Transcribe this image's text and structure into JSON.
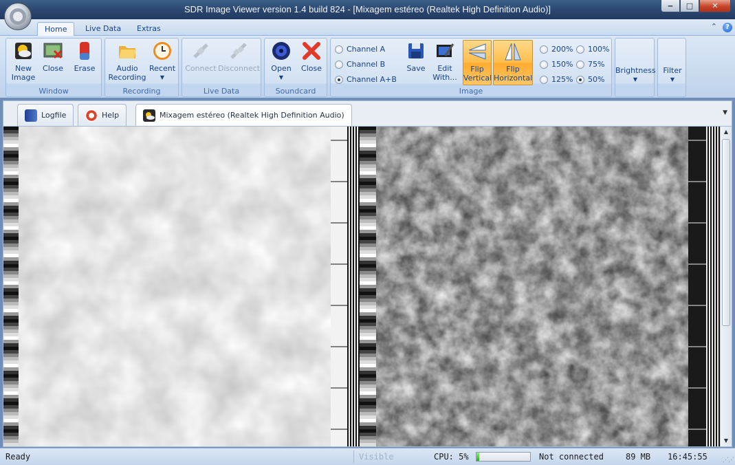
{
  "window": {
    "title": "SDR Image Viewer version 1.4 build 824 - [Mixagem estéreo (Realtek High Definition Audio)]",
    "minimize_glyph": "‒",
    "maximize_glyph": "□",
    "close_glyph": "✕"
  },
  "ribbon_tabs": [
    {
      "label": "Home"
    },
    {
      "label": "Live Data"
    },
    {
      "label": "Extras"
    }
  ],
  "ribbon": {
    "window_group": {
      "label": "Window",
      "new_image": "New\nImage",
      "close": "Close",
      "erase": "Erase"
    },
    "recording_group": {
      "label": "Recording",
      "audio_recording": "Audio\nRecording",
      "recent": "Recent"
    },
    "live_data_group": {
      "label": "Live Data",
      "connect": "Connect",
      "disconnect": "Disconnect"
    },
    "soundcard_group": {
      "label": "Soundcard",
      "open": "Open",
      "close": "Close"
    },
    "image_group": {
      "label": "Image",
      "channel_a": "Channel A",
      "channel_b": "Channel B",
      "channel_ab": "Channel A+B",
      "channel_selected": "Channel A+B",
      "save": "Save",
      "edit_with": "Edit\nWith...",
      "flip_vertical": "Flip\nVertical",
      "flip_horizontal": "Flip\nHorizontal",
      "zoom_options": [
        "200%",
        "150%",
        "125%",
        "100%",
        "75%",
        "50%"
      ],
      "zoom_selected": "50%"
    },
    "brightness": "Brightness",
    "filter": "Filter"
  },
  "doc_tabs": [
    {
      "label": "Logfile"
    },
    {
      "label": "Help"
    },
    {
      "label": "Mixagem estéreo (Realtek High Definition Audio)"
    }
  ],
  "status": {
    "ready": "Ready",
    "visible": "Visible",
    "cpu_label": "CPU: 5%",
    "cpu_percent": 5,
    "connection": "Not connected",
    "memory": "89 MB",
    "time": "16:45:55"
  },
  "colors": {
    "ribbon_text": "#15428b",
    "active_button": "#ffbd4a",
    "cpu_fill": "#26b213"
  }
}
